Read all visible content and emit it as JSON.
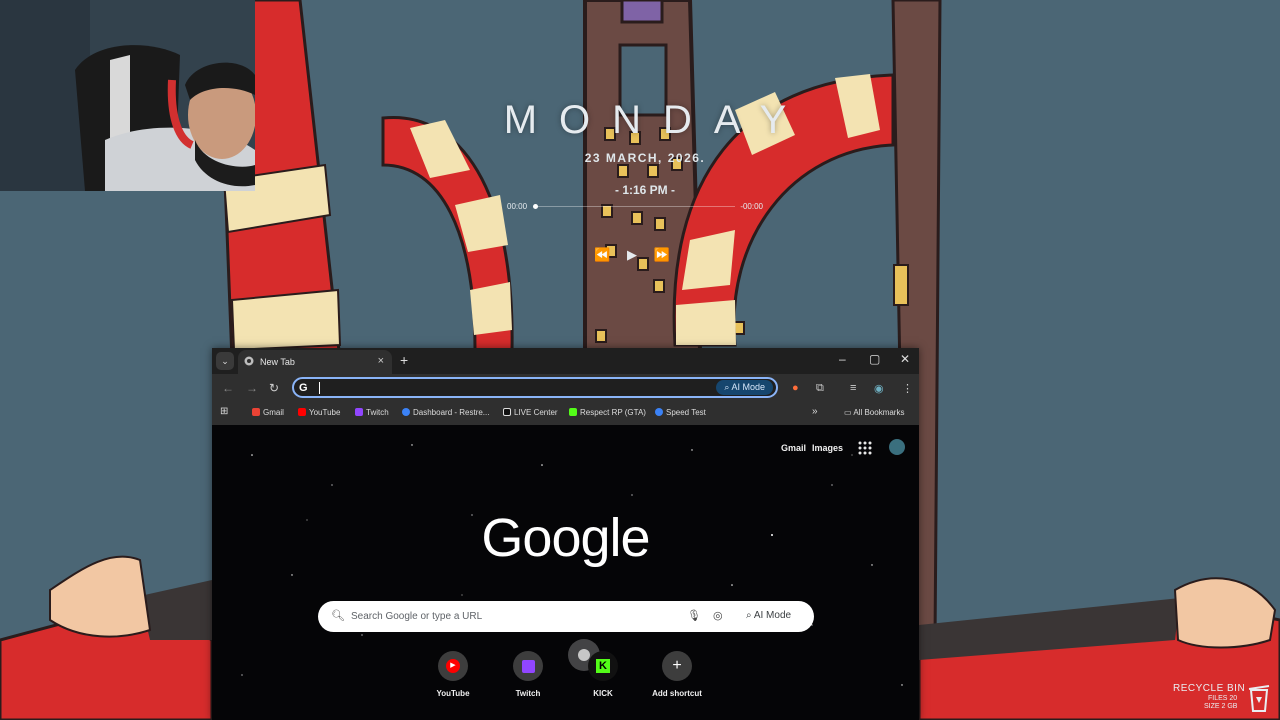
{
  "colors": {
    "wall_blue": "#4b6675",
    "tower_brown": "#6b4a44",
    "candy_red": "#d72c2c",
    "candy_cream": "#f3e3b2",
    "browser_dark": "#1f1f1f",
    "toolbar_dark": "#2f2f2f",
    "focus_blue": "#8ab4f8"
  },
  "desktop": {
    "day": "MONDAY",
    "date": "23 MARCH, 2026.",
    "time": "- 1:16 PM -",
    "player": {
      "elapsed": "00:00",
      "remaining": "-00:00",
      "progress": 0.0
    },
    "recycle_bin": {
      "title": "RECYCLE BIN",
      "files": "FILES 20",
      "size": "SIZE 2 GB"
    }
  },
  "browser": {
    "tab_title": "New Tab",
    "omnibox": {
      "value": "",
      "ai_mode_label": "AI Mode"
    },
    "bookmarks": [
      {
        "label": "Gmail",
        "icon": "gmail-icon",
        "color": "#ea4335"
      },
      {
        "label": "YouTube",
        "icon": "youtube-icon",
        "color": "#ff0000"
      },
      {
        "label": "Twitch",
        "icon": "twitch-icon",
        "color": "#9146ff"
      },
      {
        "label": "Dashboard - Restre...",
        "icon": "restream-icon",
        "color": "#3b82f6"
      },
      {
        "label": "LIVE Center",
        "icon": "tiktok-icon",
        "color": "#111111"
      },
      {
        "label": "Respect RP (GTA)",
        "icon": "kick-icon",
        "color": "#53fc18"
      },
      {
        "label": "Speed Test",
        "icon": "speedtest-icon",
        "color": "#3b82f6"
      }
    ],
    "all_bookmarks": "All Bookmarks",
    "ntp": {
      "gmail": "Gmail",
      "images": "Images",
      "logo": "Google",
      "search_placeholder": "Search Google or type a URL",
      "ai_mode": "AI Mode",
      "shortcuts": [
        {
          "label": "YouTube",
          "icon": "youtube-icon",
          "color": "#ff0000"
        },
        {
          "label": "Twitch",
          "icon": "twitch-icon",
          "color": "#9146ff"
        },
        {
          "label": "KICK",
          "icon": "kick-icon",
          "color": "#53fc18"
        },
        {
          "label": "Add shortcut",
          "icon": "plus-icon",
          "color": "#ffffff"
        }
      ]
    }
  }
}
